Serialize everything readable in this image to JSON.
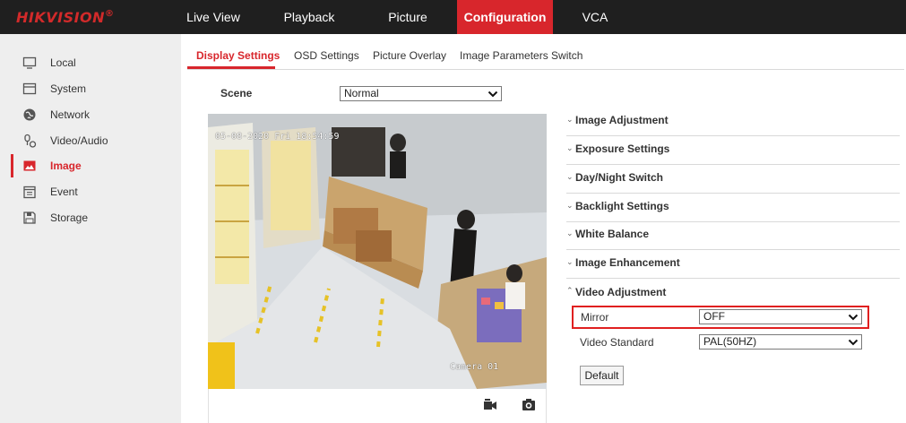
{
  "brand": {
    "logo_text": "HIKVISION",
    "reg_mark": "®",
    "accent": "#d8262c"
  },
  "topnav": [
    {
      "label": "Live View",
      "active": false
    },
    {
      "label": "Playback",
      "active": false
    },
    {
      "label": "Picture",
      "active": false
    },
    {
      "label": "Configuration",
      "active": true
    },
    {
      "label": "VCA",
      "active": false
    }
  ],
  "sidebar": {
    "items": [
      {
        "label": "Local",
        "icon": "monitor-icon",
        "active": false
      },
      {
        "label": "System",
        "icon": "system-icon",
        "active": false
      },
      {
        "label": "Network",
        "icon": "network-icon",
        "active": false
      },
      {
        "label": "Video/Audio",
        "icon": "video-audio-icon",
        "active": false
      },
      {
        "label": "Image",
        "icon": "image-icon",
        "active": true
      },
      {
        "label": "Event",
        "icon": "event-icon",
        "active": false
      },
      {
        "label": "Storage",
        "icon": "storage-icon",
        "active": false
      }
    ]
  },
  "tabs": [
    {
      "label": "Display Settings",
      "active": true
    },
    {
      "label": "OSD Settings",
      "active": false
    },
    {
      "label": "Picture Overlay",
      "active": false
    },
    {
      "label": "Image Parameters Switch",
      "active": false
    }
  ],
  "scene": {
    "label": "Scene",
    "value": "Normal"
  },
  "video": {
    "osd_time": "05-08-2020 Fri 18:54:59",
    "osd_camera": "Camera 01",
    "toolbar_icons": [
      "record-icon",
      "capture-icon"
    ]
  },
  "sections": [
    {
      "label": "Image Adjustment",
      "expanded": false
    },
    {
      "label": "Exposure Settings",
      "expanded": false
    },
    {
      "label": "Day/Night Switch",
      "expanded": false
    },
    {
      "label": "Backlight Settings",
      "expanded": false
    },
    {
      "label": "White Balance",
      "expanded": false
    },
    {
      "label": "Image Enhancement",
      "expanded": false
    },
    {
      "label": "Video Adjustment",
      "expanded": true
    }
  ],
  "video_adjustment": {
    "mirror_label": "Mirror",
    "mirror_value": "OFF",
    "standard_label": "Video Standard",
    "standard_value": "PAL(50HZ)"
  },
  "default_button": "Default"
}
